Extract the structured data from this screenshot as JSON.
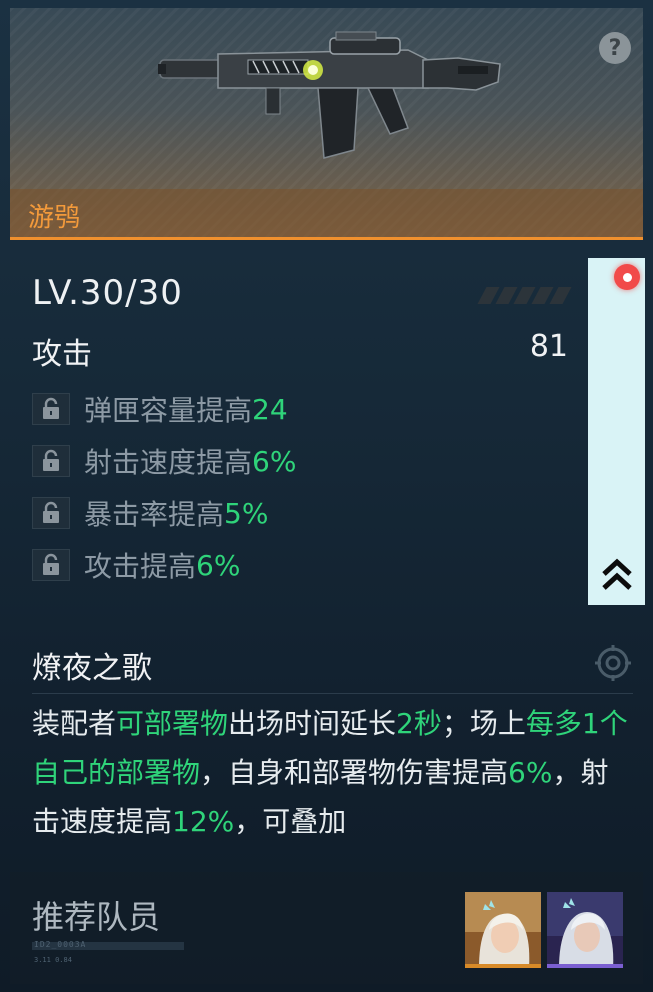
{
  "weapon": {
    "name": "游鸮"
  },
  "stats": {
    "level": "LV.30/30",
    "attack_label": "攻击",
    "attack_value": "81",
    "bonuses": [
      {
        "text": "弹匣容量提高",
        "value": "24"
      },
      {
        "text": "射击速度提高",
        "value": "6%"
      },
      {
        "text": "暴击率提高",
        "value": "5%"
      },
      {
        "text": "攻击提高",
        "value": "6%"
      }
    ]
  },
  "skill": {
    "title": "燎夜之歌",
    "desc": [
      {
        "t": "装配者",
        "hl": false
      },
      {
        "t": "可部署物",
        "hl": true
      },
      {
        "t": "出场时间延长",
        "hl": false
      },
      {
        "t": "2秒",
        "hl": true
      },
      {
        "t": "；场上",
        "hl": false
      },
      {
        "t": "每多1个自己的部署物",
        "hl": true
      },
      {
        "t": "，自身和部署物伤害提高",
        "hl": false
      },
      {
        "t": "6%",
        "hl": true
      },
      {
        "t": "，射击速度提高",
        "hl": false
      },
      {
        "t": "12%",
        "hl": true
      },
      {
        "t": "，可叠加",
        "hl": false
      }
    ]
  },
  "recommend": {
    "label": "推荐队员",
    "code": "ID2_0003A",
    "code_sub": "3.11  0.84"
  },
  "colors": {
    "accent_orange": "#f39a3b",
    "highlight_green": "#2fd47a",
    "side_tab": "#d9f3f6",
    "record_red": "#f14a4a"
  },
  "icons": {
    "help": "question-mark-icon",
    "lock": "lock-icon",
    "record": "record-icon",
    "collapse": "double-chevron-up-icon",
    "skill": "target-gear-icon"
  }
}
